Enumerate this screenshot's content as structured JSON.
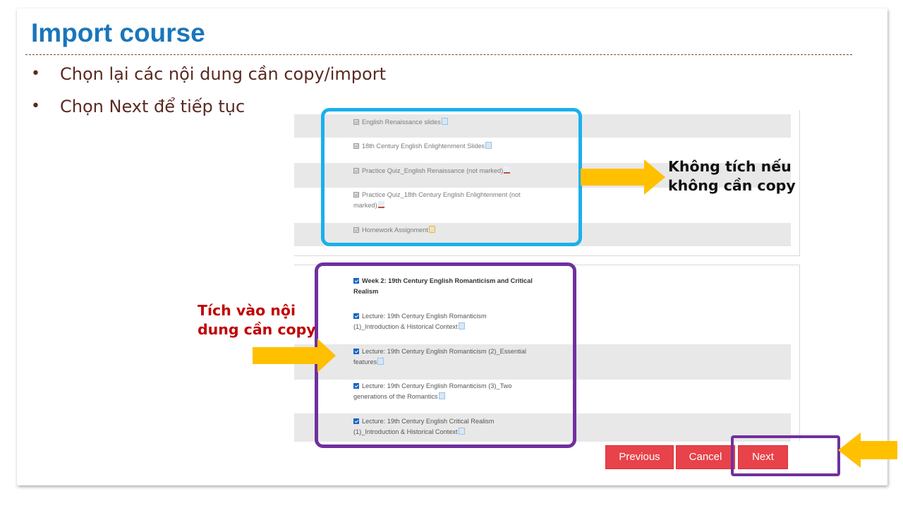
{
  "slide": {
    "title": "Import course",
    "bullets": [
      "Chọn lại các nội dung cần copy/import",
      "Chọn Next để tiếp tục"
    ]
  },
  "section1": {
    "items": [
      {
        "text": "English Renaissance slides",
        "icon": "file-icon",
        "checked": true,
        "disabled": true
      },
      {
        "text": "18th Century English Enlightenment Slides",
        "icon": "file-icon",
        "checked": true,
        "disabled": true
      },
      {
        "text": "Practice Quiz_English Renaissance (not marked)",
        "icon": "quiz-icon",
        "checked": true,
        "disabled": true
      },
      {
        "text": "Practice Quiz_18th Century English Enlightenment (not marked)",
        "icon": "quiz-icon",
        "checked": true,
        "disabled": true
      },
      {
        "text": "Homework Assignment",
        "icon": "assignment-icon",
        "checked": true,
        "disabled": true
      }
    ]
  },
  "section2": {
    "items": [
      {
        "text": "Week 2: 19th Century English Romanticism and Critical Realism",
        "checked": true
      },
      {
        "text": "Lecture: 19th Century English Romanticism (1)_Introduction & Historical Context",
        "icon": "file-icon",
        "checked": true
      },
      {
        "text": "Lecture: 19th Century English Romanticism (2)_Essential features",
        "icon": "file-icon",
        "checked": true
      },
      {
        "text": "Lecture: 19th Century English Romanticism (3)_Two generations of the Romantics",
        "icon": "file-icon",
        "checked": true
      },
      {
        "text": "Lecture: 19th Century English Critical Realism (1)_Introduction & Historical Context",
        "icon": "file-icon",
        "checked": true
      }
    ]
  },
  "buttons": {
    "previous": "Previous",
    "cancel": "Cancel",
    "next": "Next"
  },
  "annotations": {
    "uncheck_note_line1": "Không tích nếu",
    "uncheck_note_line2": "không cần copy",
    "check_note_line1": "Tích vào nội",
    "check_note_line2": "dung cần copy"
  },
  "colors": {
    "title": "#1a75bb",
    "highlight_blue": "#1ab0ec",
    "highlight_purple": "#7030a0",
    "arrow": "#ffc000",
    "button": "#e8424a",
    "note_red": "#c00000"
  }
}
